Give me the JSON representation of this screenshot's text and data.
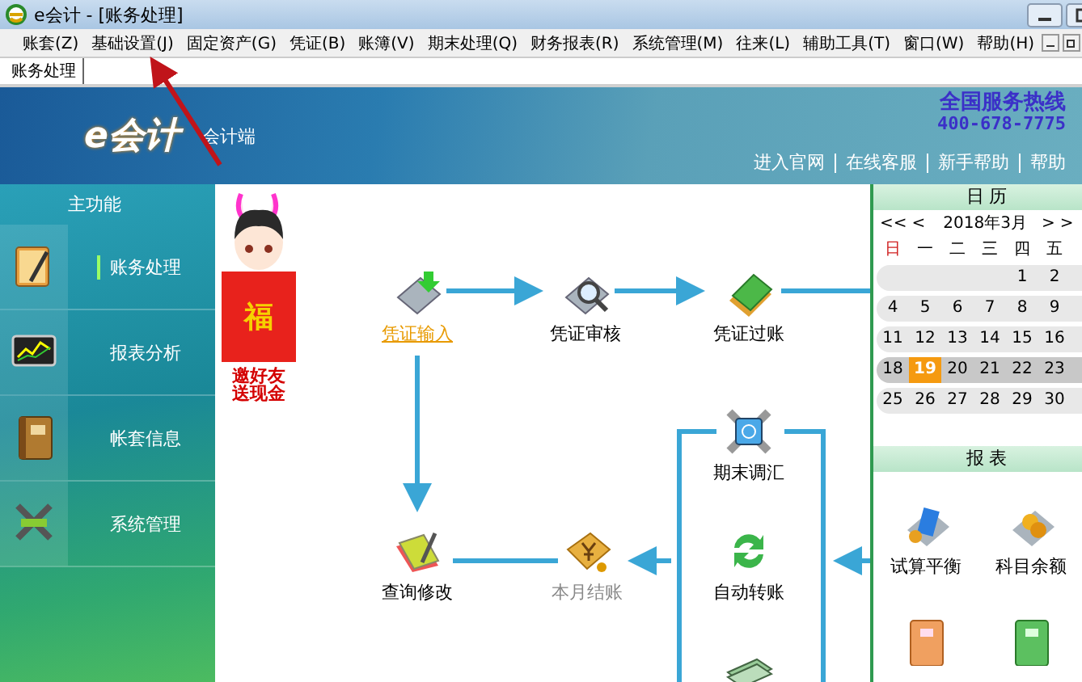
{
  "window": {
    "title": "e会计 - [账务处理]"
  },
  "menu": [
    {
      "label": "账套(Z)"
    },
    {
      "label": "基础设置(J)"
    },
    {
      "label": "固定资产(G)"
    },
    {
      "label": "凭证(B)"
    },
    {
      "label": "账簿(V)"
    },
    {
      "label": "期末处理(Q)"
    },
    {
      "label": "财务报表(R)"
    },
    {
      "label": "系统管理(M)"
    },
    {
      "label": "往来(L)"
    },
    {
      "label": "辅助工具(T)"
    },
    {
      "label": "窗口(W)"
    },
    {
      "label": "帮助(H)"
    }
  ],
  "tabs": [
    {
      "label": "账务处理",
      "selected": true
    }
  ],
  "banner": {
    "logo": "e会计",
    "subtitle": "会计端",
    "hotline_label": "全国服务热线",
    "hotline": "400-678-7775",
    "links": [
      "进入官网",
      "在线客服",
      "新手帮助",
      "帮助"
    ]
  },
  "sidebar": {
    "title": "主功能",
    "items": [
      {
        "label": "账务处理",
        "selected": true
      },
      {
        "label": "报表分析",
        "selected": false
      },
      {
        "label": "帐套信息",
        "selected": false
      },
      {
        "label": "系统管理",
        "selected": false
      }
    ]
  },
  "promo": {
    "envelope_text": "福",
    "caption": "邀好友送现金"
  },
  "flow": {
    "nodes": [
      {
        "label": "凭证输入",
        "highlighted": true,
        "disabled": false
      },
      {
        "label": "凭证审核",
        "highlighted": false,
        "disabled": false
      },
      {
        "label": "凭证过账",
        "highlighted": false,
        "disabled": false
      },
      {
        "label": "期末调汇",
        "highlighted": false,
        "disabled": false
      },
      {
        "label": "查询修改",
        "highlighted": false,
        "disabled": false
      },
      {
        "label": "本月结账",
        "highlighted": false,
        "disabled": true
      },
      {
        "label": "自动转账",
        "highlighted": false,
        "disabled": false
      }
    ]
  },
  "calendar": {
    "title": "日 历",
    "prev_year": "<<",
    "prev_month": "<",
    "month": "2018年3月",
    "next_month": ">",
    "next_year": ">",
    "weekdays": [
      {
        "label": "日",
        "weekend": true
      },
      {
        "label": "一",
        "weekend": false
      },
      {
        "label": "二",
        "weekend": false
      },
      {
        "label": "三",
        "weekend": false
      },
      {
        "label": "四",
        "weekend": false
      },
      {
        "label": "五",
        "weekend": false
      }
    ],
    "weeks": [
      {
        "current": false,
        "days": [
          {
            "kind": "blank"
          },
          {
            "kind": "blank"
          },
          {
            "kind": "blank"
          },
          {
            "kind": "blank"
          },
          {
            "kind": "day",
            "day": "1",
            "selected": false
          },
          {
            "kind": "day",
            "day": "2",
            "selected": false
          }
        ]
      },
      {
        "current": false,
        "days": [
          {
            "kind": "day",
            "day": "4",
            "selected": false
          },
          {
            "kind": "day",
            "day": "5",
            "selected": false
          },
          {
            "kind": "day",
            "day": "6",
            "selected": false
          },
          {
            "kind": "day",
            "day": "7",
            "selected": false
          },
          {
            "kind": "day",
            "day": "8",
            "selected": false
          },
          {
            "kind": "day",
            "day": "9",
            "selected": false
          }
        ]
      },
      {
        "current": false,
        "days": [
          {
            "kind": "day",
            "day": "11",
            "selected": false
          },
          {
            "kind": "day",
            "day": "12",
            "selected": false
          },
          {
            "kind": "day",
            "day": "13",
            "selected": false
          },
          {
            "kind": "day",
            "day": "14",
            "selected": false
          },
          {
            "kind": "day",
            "day": "15",
            "selected": false
          },
          {
            "kind": "day",
            "day": "16",
            "selected": false
          }
        ]
      },
      {
        "current": true,
        "days": [
          {
            "kind": "day",
            "day": "18",
            "selected": false
          },
          {
            "kind": "day",
            "day": "19",
            "selected": true
          },
          {
            "kind": "day",
            "day": "20",
            "selected": false
          },
          {
            "kind": "day",
            "day": "21",
            "selected": false
          },
          {
            "kind": "day",
            "day": "22",
            "selected": false
          },
          {
            "kind": "day",
            "day": "23",
            "selected": false
          }
        ]
      },
      {
        "current": false,
        "days": [
          {
            "kind": "day",
            "day": "25",
            "selected": false
          },
          {
            "kind": "day",
            "day": "26",
            "selected": false
          },
          {
            "kind": "day",
            "day": "27",
            "selected": false
          },
          {
            "kind": "day",
            "day": "28",
            "selected": false
          },
          {
            "kind": "day",
            "day": "29",
            "selected": false
          },
          {
            "kind": "day",
            "day": "30",
            "selected": false
          }
        ]
      }
    ]
  },
  "reports": {
    "title": "报 表",
    "items": [
      {
        "label": "试算平衡"
      },
      {
        "label": "科目余额"
      }
    ]
  }
}
